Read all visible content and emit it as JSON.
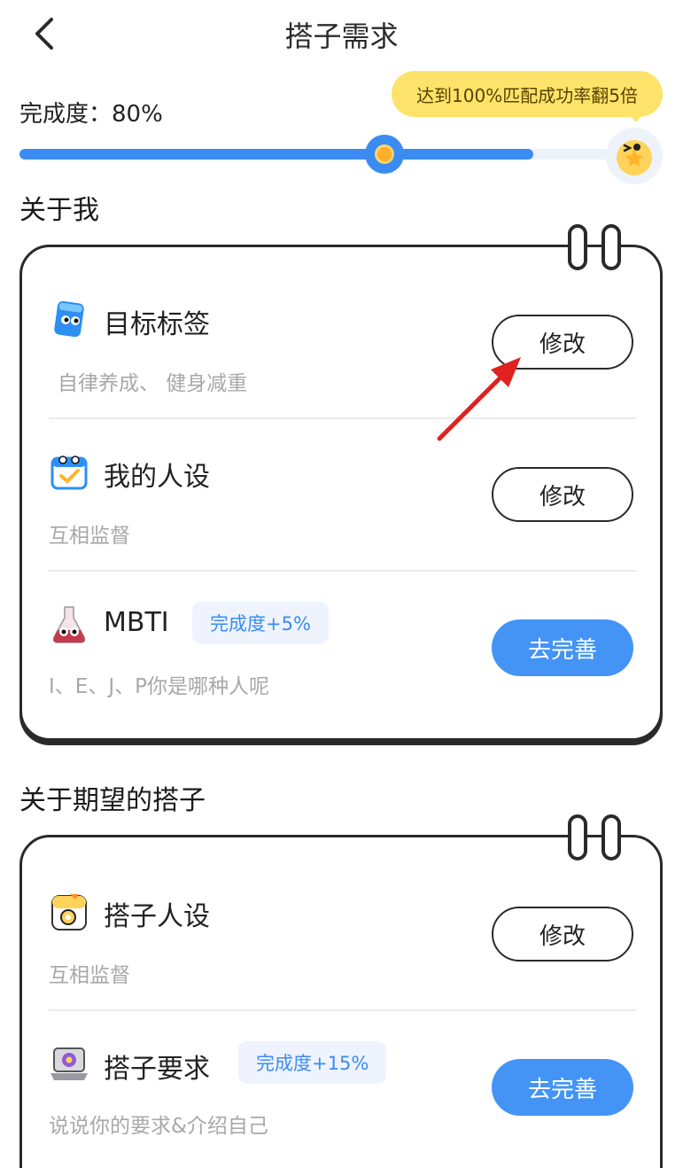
{
  "header": {
    "title": "搭子需求"
  },
  "progress": {
    "label": "完成度：80%",
    "value": 0.8,
    "tooltip": "达到100%匹配成功率翻5倍"
  },
  "about_me": {
    "title": "关于我",
    "items": [
      {
        "title": "目标标签",
        "subtitle": "自律养成、 健身减重",
        "button": "修改",
        "icon": "blue-block-mascot-icon"
      },
      {
        "title": "我的人设",
        "subtitle": "互相监督",
        "button": "修改",
        "icon": "calendar-check-icon"
      },
      {
        "title": "MBTI",
        "tag": "完成度+5%",
        "subtitle": "I、E、J、P你是哪种人呢",
        "button": "去完善",
        "icon": "potion-flask-icon"
      }
    ]
  },
  "about_partner": {
    "title": "关于期望的搭子",
    "items": [
      {
        "title": "搭子人设",
        "subtitle": "互相监督",
        "button": "修改",
        "icon": "duck-note-icon"
      },
      {
        "title": "搭子要求",
        "tag": "完成度+15%",
        "subtitle": "说说你的要求&介绍自己",
        "button": "去完善",
        "icon": "laptop-mascot-icon"
      }
    ]
  },
  "colors": {
    "accent": "#4394f5",
    "tooltip": "#fde36a",
    "annotation_arrow": "#e0211f"
  }
}
